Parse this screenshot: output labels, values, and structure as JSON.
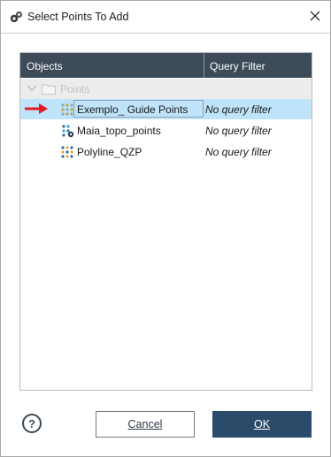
{
  "window": {
    "title": "Select Points To Add"
  },
  "tree": {
    "headers": {
      "objects": "Objects",
      "query_filter": "Query Filter"
    },
    "folder": {
      "label": "Points"
    },
    "items": [
      {
        "label": "Exemplo_ Guide Points",
        "query": "No query filter",
        "selected": true
      },
      {
        "label": "Maia_topo_points",
        "query": "No query filter",
        "selected": false
      },
      {
        "label": "Polyline_QZP",
        "query": "No query filter",
        "selected": false
      }
    ]
  },
  "footer": {
    "help_label": "?",
    "cancel_label": "Cancel",
    "ok_label": "OK"
  },
  "colors": {
    "header_bg": "#3d4a57",
    "selection_bg": "#bfe3f9",
    "ok_bg": "#2a4c6a",
    "arrow": "#e11b22"
  },
  "icons": {
    "app": "app-logo-icon",
    "close": "close-icon",
    "chevron": "chevron-down-icon",
    "folder": "folder-icon",
    "points": "points-object-icon",
    "annotation": "red-arrow-icon"
  }
}
